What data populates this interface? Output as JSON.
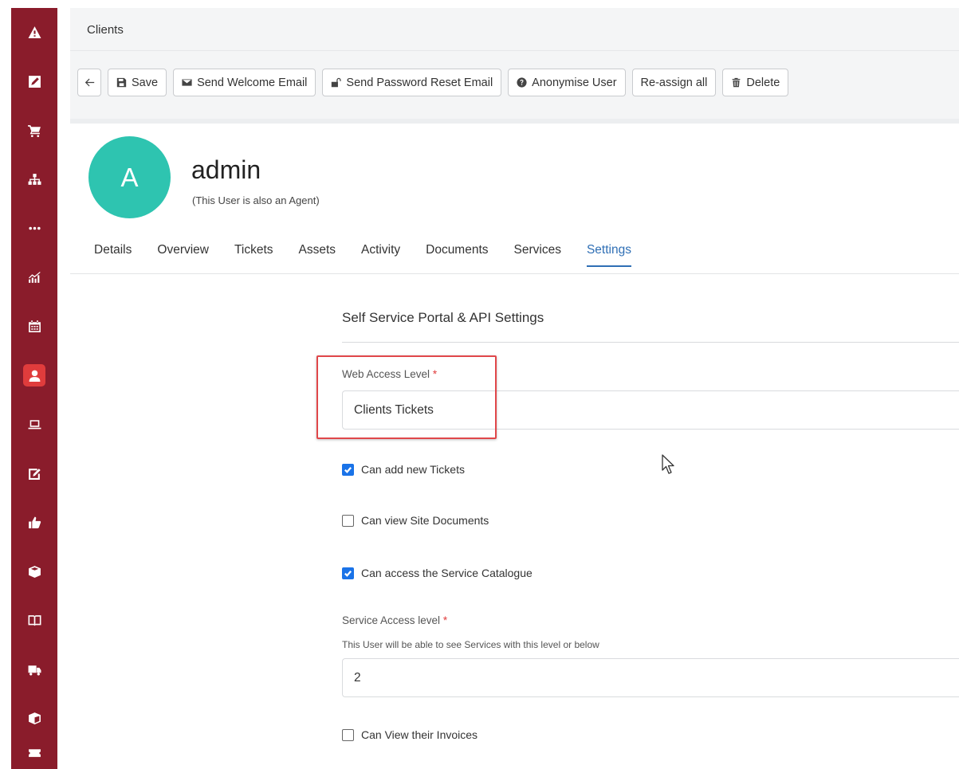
{
  "sidebar": {
    "items": [
      {
        "icon": "warning-icon"
      },
      {
        "icon": "edit-icon"
      },
      {
        "icon": "cart-icon"
      },
      {
        "icon": "org-chart-icon"
      },
      {
        "icon": "more-icon"
      },
      {
        "icon": "chart-icon"
      },
      {
        "icon": "calendar-icon"
      },
      {
        "icon": "user-icon",
        "active": true
      },
      {
        "icon": "laptop-icon"
      },
      {
        "icon": "note-edit-icon"
      },
      {
        "icon": "thumbs-up-icon"
      },
      {
        "icon": "box-icon"
      },
      {
        "icon": "book-icon"
      },
      {
        "icon": "truck-icon"
      },
      {
        "icon": "package-icon"
      },
      {
        "icon": "ticket-icon"
      }
    ],
    "active_color": "#e03c3c",
    "background": "#8a1c2b"
  },
  "header": {
    "breadcrumb": "Clients"
  },
  "toolbar": {
    "save_label": "Save",
    "welcome_label": "Send Welcome Email",
    "reset_label": "Send Password Reset Email",
    "anonymise_label": "Anonymise User",
    "reassign_label": "Re-assign all",
    "delete_label": "Delete"
  },
  "user": {
    "initial": "A",
    "name": "admin",
    "subtitle": "(This User is also an Agent)",
    "avatar_color": "#2ec4b0"
  },
  "tabs": [
    {
      "label": "Details"
    },
    {
      "label": "Overview"
    },
    {
      "label": "Tickets"
    },
    {
      "label": "Assets"
    },
    {
      "label": "Activity"
    },
    {
      "label": "Documents"
    },
    {
      "label": "Services"
    },
    {
      "label": "Settings",
      "active": true
    }
  ],
  "settings": {
    "section_title": "Self Service Portal & API Settings",
    "web_access_label": "Web Access Level",
    "web_access_value": "Clients Tickets",
    "required_mark": "*",
    "can_add_tickets_label": "Can add new Tickets",
    "can_add_tickets": true,
    "can_view_docs_label": "Can view Site Documents",
    "can_view_docs": false,
    "can_access_catalogue_label": "Can access the Service Catalogue",
    "can_access_catalogue": true,
    "service_access_label": "Service Access level",
    "service_access_hint": "This User will be able to see Services with this level or below",
    "service_access_value": "2",
    "can_view_invoices_label": "Can View their Invoices",
    "can_view_invoices": false
  }
}
